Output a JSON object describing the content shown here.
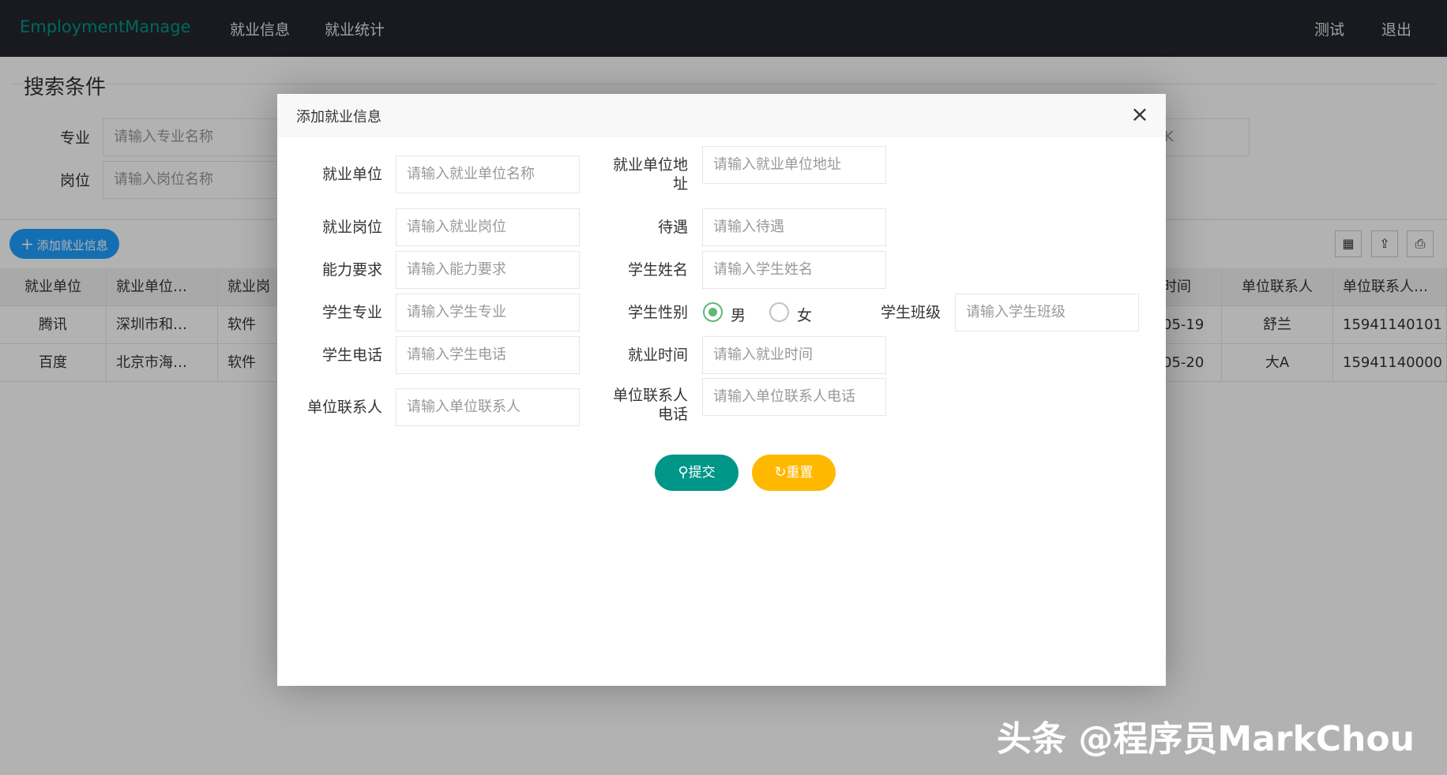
{
  "app": {
    "brand": "EmploymentManage",
    "nav": [
      "就业信息",
      "就业统计"
    ],
    "user": "测试",
    "logout": "退出"
  },
  "search": {
    "legend": "搜索条件",
    "major_label": "专业",
    "major_placeholder": "请输入专业名称",
    "post_label": "岗位",
    "post_placeholder": "请输入岗位名称",
    "right_placeholder_fragment": "K"
  },
  "toolbar": {
    "add_label": "添加就业信息"
  },
  "table": {
    "headers": [
      "就业单位",
      "就业单位…",
      "就业岗",
      "时间",
      "单位联系人",
      "单位联系人…"
    ],
    "rows": [
      [
        "腾讯",
        "深圳市和…",
        "软件",
        "05-19",
        "舒兰",
        "15941140101"
      ],
      [
        "百度",
        "北京市海…",
        "软件",
        "05-20",
        "大A",
        "15941140000"
      ]
    ]
  },
  "modal": {
    "title": "添加就业信息",
    "close": "×",
    "fields": {
      "company_label": "就业单位",
      "company_placeholder": "请输入就业单位名称",
      "address_label_1": "就业单位地",
      "address_label_2": "址",
      "address_placeholder": "请输入就业单位地址",
      "post_label": "就业岗位",
      "post_placeholder": "请输入就业岗位",
      "salary_label": "待遇",
      "salary_placeholder": "请输入待遇",
      "ability_label": "能力要求",
      "ability_placeholder": "请输入能力要求",
      "name_label": "学生姓名",
      "name_placeholder": "请输入学生姓名",
      "major_label": "学生专业",
      "major_placeholder": "请输入学生专业",
      "gender_label": "学生性别",
      "gender_male": "男",
      "gender_female": "女",
      "class_label": "学生班级",
      "class_placeholder": "请输入学生班级",
      "phone_label": "学生电话",
      "phone_placeholder": "请输入学生电话",
      "time_label": "就业时间",
      "time_placeholder": "请输入就业时间",
      "contact_label": "单位联系人",
      "contact_placeholder": "请输入单位联系人",
      "contact_phone_label_1": "单位联系人",
      "contact_phone_label_2": "电话",
      "contact_phone_placeholder": "请输入单位联系人电话"
    },
    "submit": "提交",
    "reset": "重置"
  },
  "watermark": "头条 @程序员MarkChou",
  "colors": {
    "topbar": "#23262e",
    "brand": "#009688",
    "submit": "#009688",
    "reset": "#ffb800",
    "add": "#1e9fff",
    "radio_on": "#5fb878"
  }
}
